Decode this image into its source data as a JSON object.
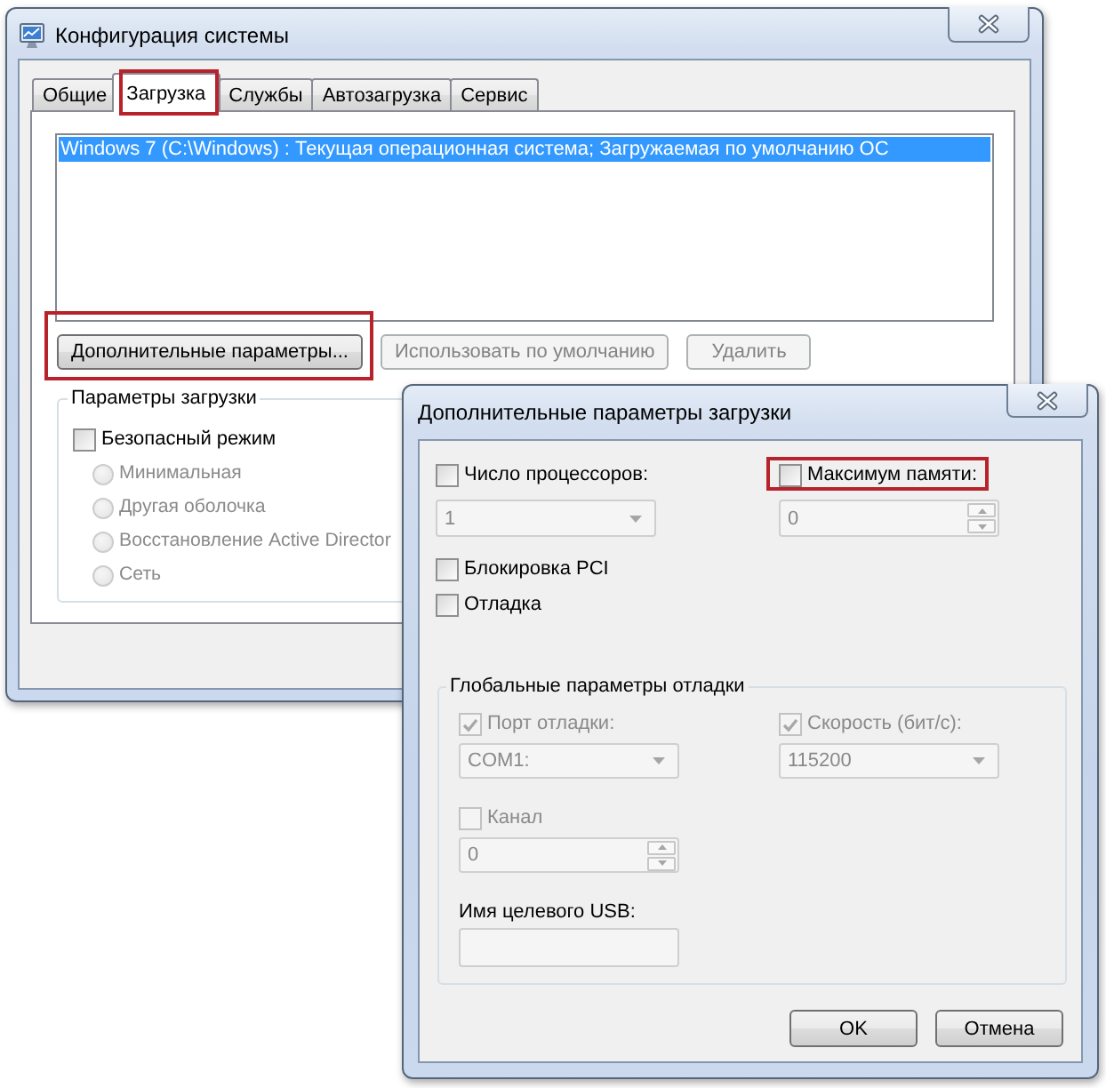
{
  "main_window": {
    "title": "Конфигурация системы",
    "tabs": [
      {
        "label": "Общие",
        "selected": false,
        "highlighted": false
      },
      {
        "label": "Загрузка",
        "selected": true,
        "highlighted": true
      },
      {
        "label": "Службы",
        "selected": false,
        "highlighted": false
      },
      {
        "label": "Автозагрузка",
        "selected": false,
        "highlighted": false
      },
      {
        "label": "Сервис",
        "selected": false,
        "highlighted": false
      }
    ],
    "boot_entries": [
      {
        "text": "Windows 7 (C:\\Windows) : Текущая операционная система; Загружаемая по умолчанию ОС",
        "selected": true
      }
    ],
    "buttons": [
      {
        "label": "Дополнительные параметры...",
        "disabled": false,
        "highlighted": true
      },
      {
        "label": "Использовать по умолчанию",
        "disabled": true,
        "highlighted": false
      },
      {
        "label": "Удалить",
        "disabled": true,
        "highlighted": false
      }
    ],
    "boot_options": {
      "title": "Параметры загрузки",
      "safe_mode": {
        "label": "Безопасный режим",
        "checked": false,
        "disabled": false
      },
      "modes": [
        {
          "label": "Минимальная",
          "selected": false,
          "disabled": true
        },
        {
          "label": "Другая оболочка",
          "selected": false,
          "disabled": true
        },
        {
          "label": "Восстановление Active Director",
          "selected": false,
          "disabled": true
        },
        {
          "label": "Сеть",
          "selected": false,
          "disabled": true
        }
      ]
    }
  },
  "dialog": {
    "title": "Дополнительные параметры загрузки",
    "settings": [
      {
        "label": "Число процессоров:",
        "checked": false,
        "disabled": false,
        "highlighted": false,
        "field": {
          "kind": "dropdown",
          "value": "1",
          "disabled": true
        }
      },
      {
        "label": "Максимум памяти:",
        "checked": false,
        "disabled": false,
        "highlighted": true,
        "field": {
          "kind": "spin",
          "value": "0",
          "disabled": true
        }
      }
    ],
    "options": [
      {
        "label": "Блокировка PCI",
        "checked": false,
        "disabled": false
      },
      {
        "label": "Отладка",
        "checked": false,
        "disabled": false
      }
    ],
    "debug_settings": {
      "title": "Глобальные параметры отладки",
      "items": [
        {
          "label": "Порт отладки:",
          "checked": true,
          "disabled": true,
          "field": {
            "kind": "dropdown",
            "value": "COM1:",
            "disabled": true
          }
        },
        {
          "label": "Скорость (бит/с):",
          "checked": true,
          "disabled": true,
          "field": {
            "kind": "dropdown",
            "value": "115200",
            "disabled": true
          }
        },
        {
          "label": "Канал",
          "checked": false,
          "disabled": true,
          "field": {
            "kind": "spin",
            "value": "0",
            "disabled": true
          }
        }
      ],
      "usb_target": {
        "label": "Имя целевого USB:",
        "field": {
          "kind": "text",
          "disabled": true
        }
      }
    },
    "buttons": [
      {
        "label": "OK"
      },
      {
        "label": "Отмена"
      }
    ]
  }
}
